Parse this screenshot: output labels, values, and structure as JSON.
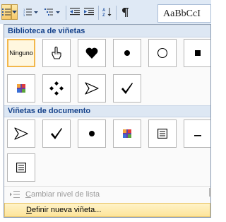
{
  "toolbar": {
    "buttons": [
      {
        "name": "bullets-button",
        "icon": "bullets-icon",
        "active": true
      },
      {
        "name": "bullets-dropdown",
        "icon": "chevron-down-icon",
        "active": true
      },
      {
        "name": "numbering-button",
        "icon": "numbering-icon",
        "active": false
      },
      {
        "name": "multilevel-list-button",
        "icon": "multilevel-list-icon",
        "active": false
      },
      {
        "name": "decrease-indent-button",
        "icon": "decrease-indent-icon",
        "active": false
      },
      {
        "name": "increase-indent-button",
        "icon": "increase-indent-icon",
        "active": false
      },
      {
        "name": "sort-button",
        "icon": "sort-az-icon",
        "active": false
      },
      {
        "name": "show-formatting-button",
        "icon": "pilcrow-icon",
        "active": false
      }
    ],
    "style_preview": "AaBbCcI"
  },
  "menu": {
    "library_header": "Biblioteca de viñetas",
    "library_tiles": [
      {
        "name": "bullet-none-tile",
        "label": "Ninguno",
        "icon": "none",
        "selected": true
      },
      {
        "name": "bullet-hand-tile",
        "icon": "hand-pointer-icon"
      },
      {
        "name": "bullet-heart-tile",
        "icon": "heart-icon"
      },
      {
        "name": "bullet-dot-tile",
        "icon": "filled-circle-icon"
      },
      {
        "name": "bullet-circle-tile",
        "icon": "hollow-circle-icon"
      },
      {
        "name": "bullet-square-tile",
        "icon": "filled-square-icon"
      },
      {
        "name": "bullet-colored-cross-tile",
        "icon": "colored-cross-icon"
      },
      {
        "name": "bullet-diamond-cluster-tile",
        "icon": "diamond-cluster-icon"
      },
      {
        "name": "bullet-arrowhead-tile",
        "icon": "arrowhead-icon"
      },
      {
        "name": "bullet-checkmark-tile",
        "icon": "checkmark-icon"
      }
    ],
    "document_header": "Viñetas de documento",
    "document_tiles": [
      {
        "name": "doc-bullet-arrowhead-tile",
        "icon": "arrowhead-icon"
      },
      {
        "name": "doc-bullet-checkmark-tile",
        "icon": "checkmark-icon"
      },
      {
        "name": "doc-bullet-dot-tile",
        "icon": "filled-circle-icon"
      },
      {
        "name": "doc-bullet-colored-cross-tile",
        "icon": "colored-cross-icon"
      },
      {
        "name": "doc-bullet-boxed-lines-tile",
        "icon": "boxed-lines-icon"
      },
      {
        "name": "doc-bullet-dash-tile",
        "icon": "dash-icon"
      },
      {
        "name": "doc-bullet-boxed-lines-2-tile",
        "icon": "boxed-lines-icon"
      }
    ],
    "change_level_label": "Cambiar nivel de lista",
    "define_new_label": "Definir nueva viñeta..."
  },
  "colors": {
    "accent": "#15428b",
    "highlight": "#fde49a",
    "selected_border": "#f2b74c"
  }
}
